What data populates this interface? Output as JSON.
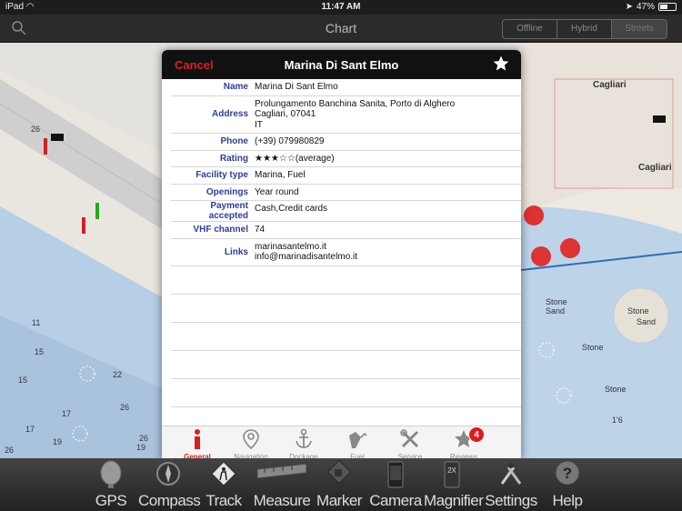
{
  "status_bar": {
    "device": "iPad",
    "time": "11:47 AM",
    "battery": "47%",
    "battery_level": 0.47
  },
  "nav_bar": {
    "title": "Chart",
    "map_modes": [
      "Offline",
      "Hybrid",
      "Streets"
    ],
    "selected_mode": "Streets"
  },
  "map": {
    "labels": [
      "Cagliari",
      "Cagliari",
      "Stone Sand",
      "Stone",
      "Stone",
      "Stone",
      "Sand"
    ],
    "depths": [
      "11",
      "15",
      "15",
      "22",
      "17",
      "19",
      "17",
      "26",
      "19",
      "26",
      "26",
      "26",
      "1'6"
    ]
  },
  "modal": {
    "cancel_label": "Cancel",
    "title": "Marina Di Sant Elmo",
    "fields": [
      {
        "label": "Name",
        "value": [
          "Marina Di Sant Elmo"
        ]
      },
      {
        "label": "Address",
        "value": [
          "Prolungamento Banchina Sanita, Porto di Alghero",
          "Cagliari, 07041",
          "IT"
        ]
      },
      {
        "label": "Phone",
        "value": [
          "(+39) 079980829"
        ]
      },
      {
        "label": "Rating",
        "value": [
          "★★★☆☆(average)"
        ]
      },
      {
        "label": "Facility type",
        "value": [
          "Marina, Fuel"
        ]
      },
      {
        "label": "Openings",
        "value": [
          "Year round"
        ]
      },
      {
        "label": "Payment accepted",
        "value": [
          "Cash,Credit cards"
        ]
      },
      {
        "label": "VHF channel",
        "value": [
          "74"
        ]
      },
      {
        "label": "Links",
        "value": [
          "marinasantelmo.it",
          "info@marinadisantelmo.it"
        ]
      }
    ],
    "rating_value": 3,
    "rating_max": 5,
    "tabs": [
      {
        "label": "General",
        "icon": "info-icon",
        "active": true
      },
      {
        "label": "Navigation",
        "icon": "location-pin-icon",
        "active": false
      },
      {
        "label": "Dockage",
        "icon": "anchor-icon",
        "active": false
      },
      {
        "label": "Fuel",
        "icon": "fuel-pump-icon",
        "active": false
      },
      {
        "label": "Service",
        "icon": "tools-icon",
        "active": false
      },
      {
        "label": "Reviews",
        "icon": "star-icon",
        "active": false,
        "badge": "4"
      }
    ]
  },
  "toolbar": {
    "items": [
      {
        "label": "GPS",
        "icon": "satellite-dish-icon"
      },
      {
        "label": "Compass",
        "icon": "compass-icon"
      },
      {
        "label": "Track",
        "icon": "track-sign-icon"
      },
      {
        "label": "Measure",
        "icon": "ruler-icon"
      },
      {
        "label": "Marker",
        "icon": "marker-icon"
      },
      {
        "label": "Camera",
        "icon": "camera-icon"
      },
      {
        "label": "Magnifier",
        "icon": "magnifier-icon"
      },
      {
        "label": "Settings",
        "icon": "settings-tools-icon"
      },
      {
        "label": "Help",
        "icon": "help-icon"
      }
    ]
  },
  "colors": {
    "accent_red": "#e31d1d",
    "label_blue": "#2c3d9a",
    "header_black": "#111111"
  }
}
